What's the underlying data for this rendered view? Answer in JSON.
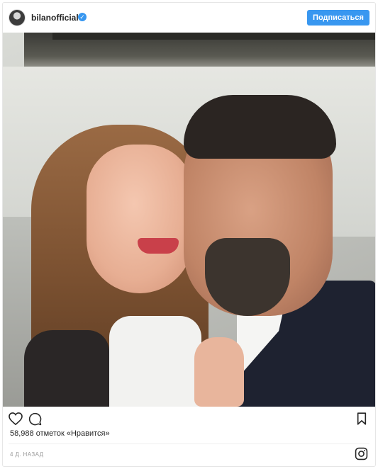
{
  "header": {
    "username": "bilanofficial",
    "verified_glyph": "✓",
    "follow_label": "Подписаться"
  },
  "photo": {
    "alt_description": ""
  },
  "actions": {
    "like_icon": "heart-icon",
    "comment_icon": "comment-icon",
    "save_icon": "bookmark-icon"
  },
  "likes_text": "58,988 отметок «Нравится»",
  "timestamp": "4 Д. НАЗАД",
  "footer_icon": "instagram-icon",
  "colors": {
    "accent": "#3897f0",
    "text": "#262626",
    "muted": "#999999"
  }
}
